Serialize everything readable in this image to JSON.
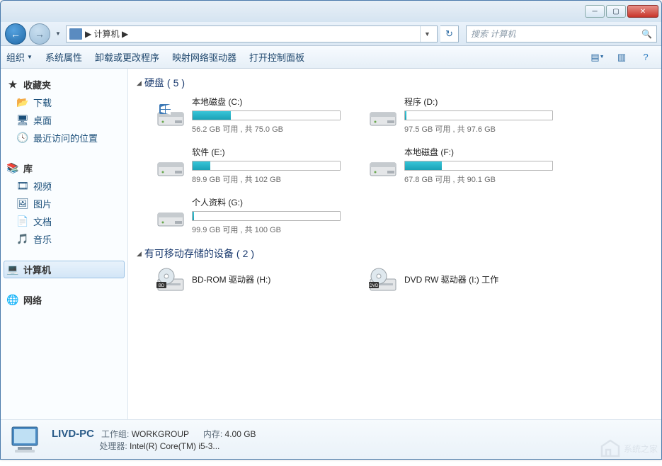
{
  "breadcrumb": {
    "location": "计算机",
    "sep": "▶"
  },
  "search": {
    "placeholder": "搜索 计算机"
  },
  "toolbar": {
    "organize": "组织",
    "items": [
      "系统属性",
      "卸载或更改程序",
      "映射网络驱动器",
      "打开控制面板"
    ]
  },
  "sidebar": {
    "favorites": {
      "label": "收藏夹",
      "items": [
        "下载",
        "桌面",
        "最近访问的位置"
      ]
    },
    "libraries": {
      "label": "库",
      "items": [
        "视频",
        "图片",
        "文档",
        "音乐"
      ]
    },
    "computer": {
      "label": "计算机"
    },
    "network": {
      "label": "网络"
    }
  },
  "groups": {
    "hdd": {
      "label": "硬盘",
      "count": 5
    },
    "removable": {
      "label": "有可移动存储的设备",
      "count": 2
    }
  },
  "drives": [
    {
      "label": "本地磁盘 (C:)",
      "status": "56.2 GB 可用 , 共 75.0 GB",
      "fill": 26,
      "os": true
    },
    {
      "label": "程序 (D:)",
      "status": "97.5 GB 可用 , 共 97.6 GB",
      "fill": 1
    },
    {
      "label": "软件 (E:)",
      "status": "89.9 GB 可用 , 共 102 GB",
      "fill": 12
    },
    {
      "label": "本地磁盘 (F:)",
      "status": "67.8 GB 可用 , 共 90.1 GB",
      "fill": 25
    },
    {
      "label": "个人资料 (G:)",
      "status": "99.9 GB 可用 , 共 100 GB",
      "fill": 1
    }
  ],
  "removable": [
    {
      "label": "BD-ROM 驱动器 (H:)",
      "kind": "bd"
    },
    {
      "label": "DVD RW 驱动器 (I:) 工作",
      "kind": "dvd"
    }
  ],
  "details": {
    "name": "LIVD-PC",
    "workgroup_label": "工作组:",
    "workgroup": "WORKGROUP",
    "memory_label": "内存:",
    "memory": "4.00 GB",
    "cpu_label": "处理器:",
    "cpu": "Intel(R) Core(TM) i5-3..."
  },
  "watermark": "系统之家"
}
